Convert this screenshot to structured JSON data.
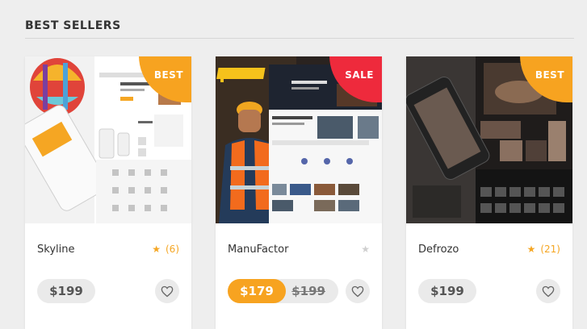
{
  "section": {
    "title": "BEST SELLERS"
  },
  "cards": [
    {
      "name": "Skyline",
      "badge": "BEST",
      "rating_count": "(6)",
      "price": "$199",
      "colors": {
        "badge": "#f7a320"
      }
    },
    {
      "name": "ManuFactor",
      "badge": "SALE",
      "sale_price": "$179",
      "old_price": "$199",
      "colors": {
        "badge": "#ee2a3c"
      }
    },
    {
      "name": "Defrozo",
      "badge": "BEST",
      "rating_count": "(21)",
      "price": "$199",
      "colors": {
        "badge": "#f7a320"
      }
    }
  ],
  "icons": {
    "star": "star-icon",
    "heart": "heart-icon"
  },
  "colors": {
    "accent": "#f7a320",
    "sale": "#ee2a3c",
    "pill": "#eaeaea"
  }
}
